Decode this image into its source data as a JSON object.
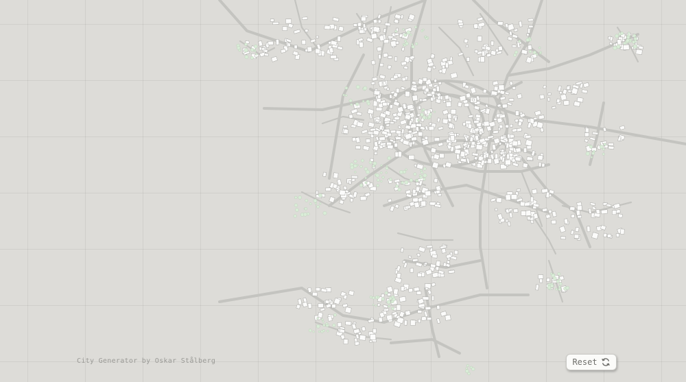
{
  "credit": "City Generator by Oskar Stålberg",
  "reset": {
    "label": "Reset",
    "icon": "refresh-icon"
  },
  "colors": {
    "background": "#dddcd8",
    "grid": "#cfcfcb",
    "road": "#c4c4c0",
    "building": "#fbfbfa",
    "tree": "#d9ecd7",
    "text": "#9a9a96"
  }
}
